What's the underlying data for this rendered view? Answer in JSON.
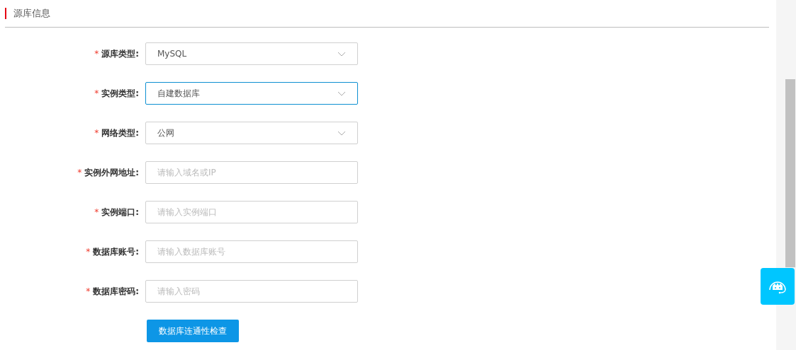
{
  "section": {
    "title": "源库信息"
  },
  "fields": [
    {
      "kind": "select",
      "label": "源库类型:",
      "required_mark": "*",
      "value": "MySQL",
      "focused": false
    },
    {
      "kind": "select",
      "label": "实例类型:",
      "required_mark": "*",
      "value": "自建数据库",
      "focused": true
    },
    {
      "kind": "select",
      "label": "网络类型:",
      "required_mark": "*",
      "value": "公网",
      "focused": false
    },
    {
      "kind": "input",
      "label": "实例外网地址:",
      "required_mark": "*",
      "placeholder": "请输入域名或IP",
      "focused": false
    },
    {
      "kind": "input",
      "label": "实例端口:",
      "required_mark": "*",
      "placeholder": "请输入实例端口",
      "focused": false
    },
    {
      "kind": "input",
      "label": "数据库账号:",
      "required_mark": "*",
      "placeholder": "请输入数据库账号",
      "focused": false
    },
    {
      "kind": "input",
      "label": "数据库密码:",
      "required_mark": "*",
      "placeholder": "请输入密码",
      "focused": false
    }
  ],
  "check_button": "数据库连通性检查"
}
